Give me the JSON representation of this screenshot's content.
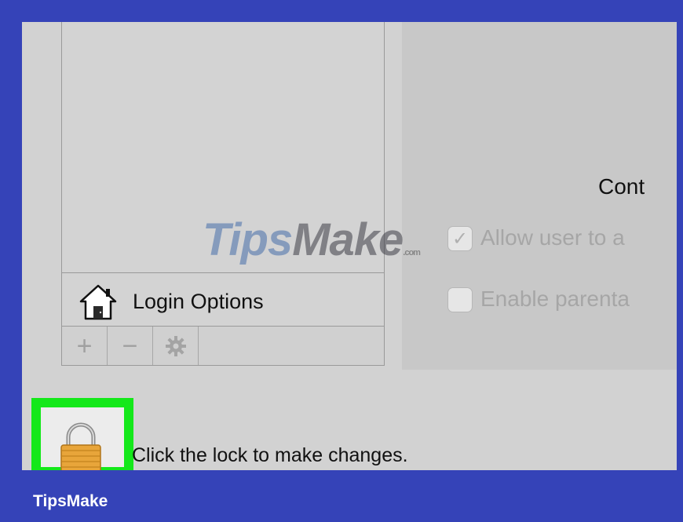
{
  "sidebar": {
    "login_options_label": "Login Options",
    "toolbar": {
      "add_glyph": "+",
      "remove_glyph": "−",
      "settings_icon": "gear-icon"
    }
  },
  "main": {
    "heading": "Cont",
    "options": [
      {
        "label": "Allow user to a",
        "checked": true
      },
      {
        "label": "Enable parenta",
        "checked": false
      }
    ]
  },
  "lock": {
    "icon": "lock-icon",
    "text": "Click the lock to make changes."
  },
  "watermark": {
    "tips": "Tips",
    "make": "Make",
    "suffix": ".com"
  },
  "footer": {
    "brand": "TipsMake"
  },
  "colors": {
    "frame": "#3543b8",
    "highlight": "#14e81a",
    "window_bg": "#d2d2d2"
  }
}
